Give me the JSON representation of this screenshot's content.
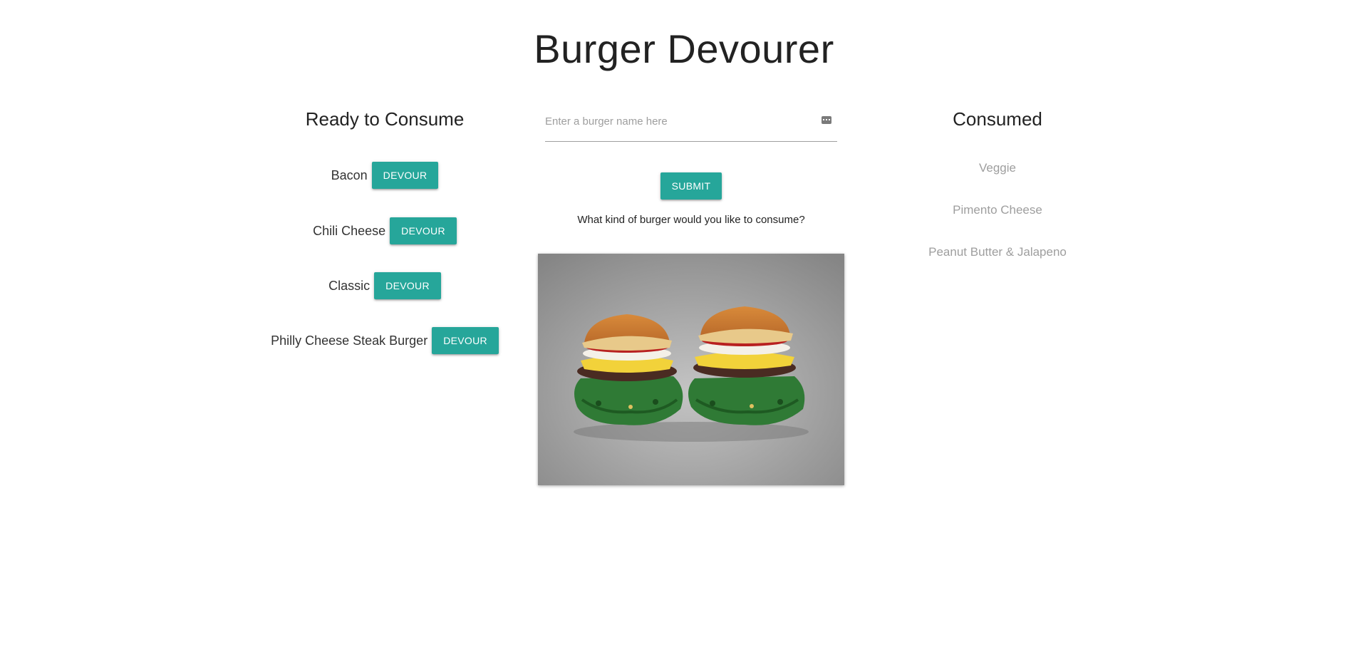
{
  "header": {
    "title": "Burger Devourer"
  },
  "ready": {
    "heading": "Ready to Consume",
    "button_label": "Devour",
    "items": [
      {
        "name": "Bacon"
      },
      {
        "name": "Chili Cheese"
      },
      {
        "name": "Classic"
      },
      {
        "name": "Philly Cheese Steak Burger"
      }
    ]
  },
  "form": {
    "placeholder": "Enter a burger name here",
    "value": "",
    "submit_label": "Submit",
    "prompt": "What kind of burger would you like to consume?"
  },
  "consumed": {
    "heading": "Consumed",
    "items": [
      {
        "name": "Veggie"
      },
      {
        "name": "Pimento Cheese"
      },
      {
        "name": "Peanut Butter & Jalapeno"
      }
    ]
  },
  "image": {
    "icon": "burger-sculpture-image"
  },
  "colors": {
    "accent": "#26a69a",
    "consumed_text": "#9e9e9e"
  }
}
